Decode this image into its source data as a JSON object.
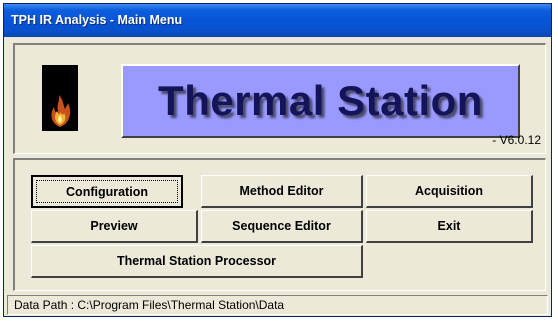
{
  "window": {
    "title": "TPH IR Analysis - Main Menu"
  },
  "header": {
    "product_name": "Thermal Station",
    "version": "- V6.0.12",
    "logo_icon": "flame-icon"
  },
  "buttons": {
    "configuration": "Configuration",
    "method_editor": "Method Editor",
    "acquisition": "Acquisition",
    "preview": "Preview",
    "sequence_editor": "Sequence Editor",
    "exit": "Exit",
    "processor": "Thermal Station Processor"
  },
  "status": {
    "data_path": "Data Path :  C:\\Program Files\\Thermal Station\\Data"
  },
  "colors": {
    "titlebar": "#0654d6",
    "banner": "#9999ff",
    "banner_text": "#14145a",
    "window_bg": "#ece9d8"
  }
}
